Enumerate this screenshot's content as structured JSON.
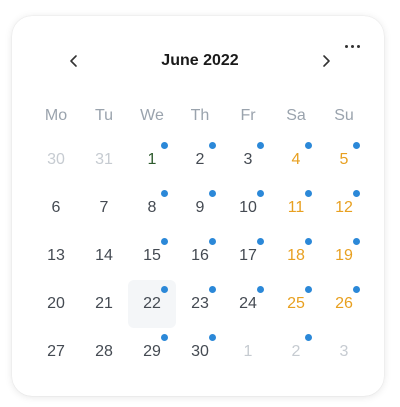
{
  "calendar": {
    "title": "June 2022",
    "prev_icon": "chevron-left-icon",
    "next_icon": "chevron-right-icon",
    "more_icon": "ellipsis-horizontal-icon",
    "weekdays": [
      "Mo",
      "Tu",
      "We",
      "Th",
      "Fr",
      "Sa",
      "Su"
    ],
    "colors": {
      "weekend": "#e8a020",
      "event_dot": "#2b88d8",
      "muted": "#c6cbd1",
      "text": "#444a52"
    },
    "days": [
      {
        "label": "30",
        "other": true,
        "weekend": false,
        "dot": false
      },
      {
        "label": "31",
        "other": true,
        "weekend": false,
        "dot": false
      },
      {
        "label": "1",
        "other": false,
        "weekend": false,
        "dot": true,
        "today": true
      },
      {
        "label": "2",
        "other": false,
        "weekend": false,
        "dot": true
      },
      {
        "label": "3",
        "other": false,
        "weekend": false,
        "dot": true
      },
      {
        "label": "4",
        "other": false,
        "weekend": true,
        "dot": true
      },
      {
        "label": "5",
        "other": false,
        "weekend": true,
        "dot": true
      },
      {
        "label": "6",
        "other": false,
        "weekend": false,
        "dot": false
      },
      {
        "label": "7",
        "other": false,
        "weekend": false,
        "dot": false
      },
      {
        "label": "8",
        "other": false,
        "weekend": false,
        "dot": true
      },
      {
        "label": "9",
        "other": false,
        "weekend": false,
        "dot": true
      },
      {
        "label": "10",
        "other": false,
        "weekend": false,
        "dot": true
      },
      {
        "label": "11",
        "other": false,
        "weekend": true,
        "dot": true
      },
      {
        "label": "12",
        "other": false,
        "weekend": true,
        "dot": true
      },
      {
        "label": "13",
        "other": false,
        "weekend": false,
        "dot": false
      },
      {
        "label": "14",
        "other": false,
        "weekend": false,
        "dot": false
      },
      {
        "label": "15",
        "other": false,
        "weekend": false,
        "dot": true
      },
      {
        "label": "16",
        "other": false,
        "weekend": false,
        "dot": true
      },
      {
        "label": "17",
        "other": false,
        "weekend": false,
        "dot": true
      },
      {
        "label": "18",
        "other": false,
        "weekend": true,
        "dot": true
      },
      {
        "label": "19",
        "other": false,
        "weekend": true,
        "dot": true
      },
      {
        "label": "20",
        "other": false,
        "weekend": false,
        "dot": false
      },
      {
        "label": "21",
        "other": false,
        "weekend": false,
        "dot": false
      },
      {
        "label": "22",
        "other": false,
        "weekend": false,
        "dot": true,
        "selected": true
      },
      {
        "label": "23",
        "other": false,
        "weekend": false,
        "dot": true
      },
      {
        "label": "24",
        "other": false,
        "weekend": false,
        "dot": true
      },
      {
        "label": "25",
        "other": false,
        "weekend": true,
        "dot": true
      },
      {
        "label": "26",
        "other": false,
        "weekend": true,
        "dot": true
      },
      {
        "label": "27",
        "other": false,
        "weekend": false,
        "dot": false
      },
      {
        "label": "28",
        "other": false,
        "weekend": false,
        "dot": false
      },
      {
        "label": "29",
        "other": false,
        "weekend": false,
        "dot": true
      },
      {
        "label": "30",
        "other": false,
        "weekend": false,
        "dot": true
      },
      {
        "label": "1",
        "other": true,
        "weekend": false,
        "dot": false
      },
      {
        "label": "2",
        "other": true,
        "weekend": false,
        "dot": true
      },
      {
        "label": "3",
        "other": true,
        "weekend": false,
        "dot": false
      }
    ]
  }
}
